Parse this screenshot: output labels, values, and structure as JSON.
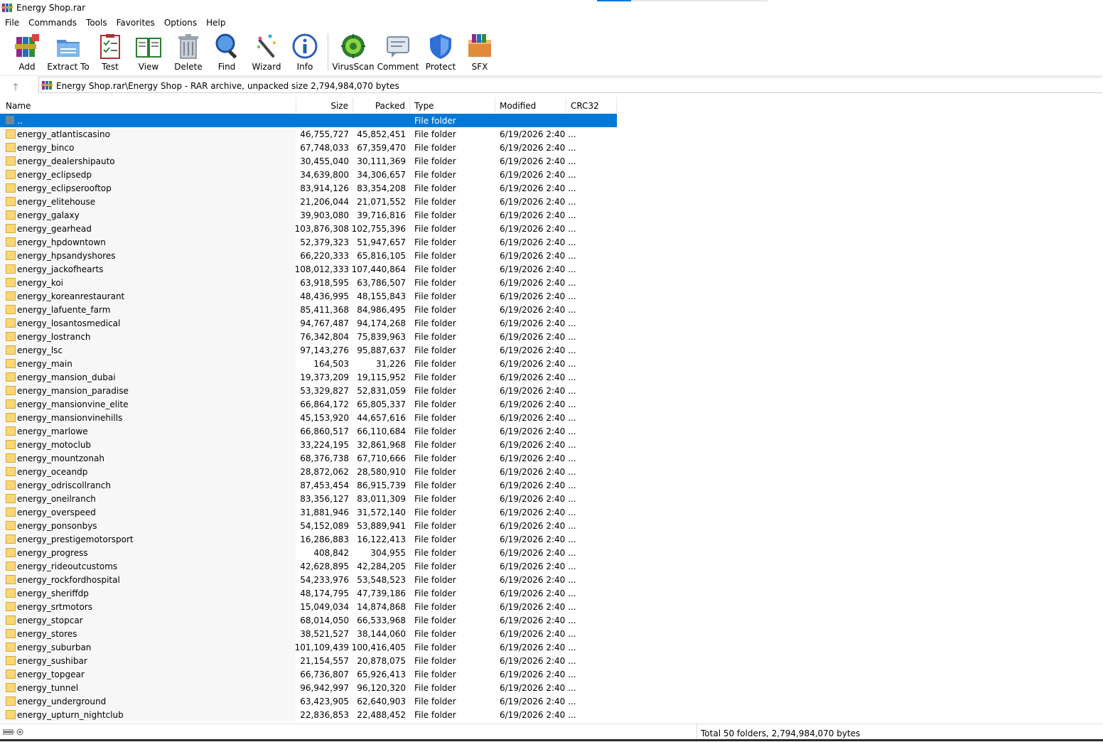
{
  "window": {
    "title": "Energy Shop.rar"
  },
  "menu": [
    "File",
    "Commands",
    "Tools",
    "Favorites",
    "Options",
    "Help"
  ],
  "toolbar": {
    "add": "Add",
    "extract_to": "Extract To",
    "test": "Test",
    "view": "View",
    "delete": "Delete",
    "find": "Find",
    "wizard": "Wizard",
    "info": "Info",
    "virusscan": "VirusScan",
    "comment": "Comment",
    "protect": "Protect",
    "sfx": "SFX"
  },
  "address": {
    "path": "Energy Shop.rar\\Energy Shop - RAR archive, unpacked size 2,794,984,070 bytes"
  },
  "columns": {
    "name": "Name",
    "size": "Size",
    "packed": "Packed",
    "type": "Type",
    "modified": "Modified",
    "crc32": "CRC32"
  },
  "parent_row": {
    "name": "..",
    "type": "File folder"
  },
  "files": [
    {
      "name": "energy_atlantiscasino",
      "size": "46,755,727",
      "packed": "45,852,451",
      "type": "File folder",
      "modified": "6/19/2026 2:40 ..."
    },
    {
      "name": "energy_binco",
      "size": "67,748,033",
      "packed": "67,359,470",
      "type": "File folder",
      "modified": "6/19/2026 2:40 ..."
    },
    {
      "name": "energy_dealershipauto",
      "size": "30,455,040",
      "packed": "30,111,369",
      "type": "File folder",
      "modified": "6/19/2026 2:40 ..."
    },
    {
      "name": "energy_eclipsedp",
      "size": "34,639,800",
      "packed": "34,306,657",
      "type": "File folder",
      "modified": "6/19/2026 2:40 ..."
    },
    {
      "name": "energy_eclipserooftop",
      "size": "83,914,126",
      "packed": "83,354,208",
      "type": "File folder",
      "modified": "6/19/2026 2:40 ..."
    },
    {
      "name": "energy_elitehouse",
      "size": "21,206,044",
      "packed": "21,071,552",
      "type": "File folder",
      "modified": "6/19/2026 2:40 ..."
    },
    {
      "name": "energy_galaxy",
      "size": "39,903,080",
      "packed": "39,716,816",
      "type": "File folder",
      "modified": "6/19/2026 2:40 ..."
    },
    {
      "name": "energy_gearhead",
      "size": "103,876,308",
      "packed": "102,755,396",
      "type": "File folder",
      "modified": "6/19/2026 2:40 ..."
    },
    {
      "name": "energy_hpdowntown",
      "size": "52,379,323",
      "packed": "51,947,657",
      "type": "File folder",
      "modified": "6/19/2026 2:40 ..."
    },
    {
      "name": "energy_hpsandyshores",
      "size": "66,220,333",
      "packed": "65,816,105",
      "type": "File folder",
      "modified": "6/19/2026 2:40 ..."
    },
    {
      "name": "energy_jackofhearts",
      "size": "108,012,333",
      "packed": "107,440,864",
      "type": "File folder",
      "modified": "6/19/2026 2:40 ..."
    },
    {
      "name": "energy_koi",
      "size": "63,918,595",
      "packed": "63,786,507",
      "type": "File folder",
      "modified": "6/19/2026 2:40 ..."
    },
    {
      "name": "energy_koreanrestaurant",
      "size": "48,436,995",
      "packed": "48,155,843",
      "type": "File folder",
      "modified": "6/19/2026 2:40 ..."
    },
    {
      "name": "energy_lafuente_farm",
      "size": "85,411,368",
      "packed": "84,986,495",
      "type": "File folder",
      "modified": "6/19/2026 2:40 ..."
    },
    {
      "name": "energy_losantosmedical",
      "size": "94,767,487",
      "packed": "94,174,268",
      "type": "File folder",
      "modified": "6/19/2026 2:40 ..."
    },
    {
      "name": "energy_lostranch",
      "size": "76,342,804",
      "packed": "75,839,963",
      "type": "File folder",
      "modified": "6/19/2026 2:40 ..."
    },
    {
      "name": "energy_lsc",
      "size": "97,143,276",
      "packed": "95,887,637",
      "type": "File folder",
      "modified": "6/19/2026 2:40 ..."
    },
    {
      "name": "energy_main",
      "size": "164,503",
      "packed": "31,226",
      "type": "File folder",
      "modified": "6/19/2026 2:40 ..."
    },
    {
      "name": "energy_mansion_dubai",
      "size": "19,373,209",
      "packed": "19,115,952",
      "type": "File folder",
      "modified": "6/19/2026 2:40 ..."
    },
    {
      "name": "energy_mansion_paradise",
      "size": "53,329,827",
      "packed": "52,831,059",
      "type": "File folder",
      "modified": "6/19/2026 2:40 ..."
    },
    {
      "name": "energy_mansionvine_elite",
      "size": "66,864,172",
      "packed": "65,805,337",
      "type": "File folder",
      "modified": "6/19/2026 2:40 ..."
    },
    {
      "name": "energy_mansionvinehills",
      "size": "45,153,920",
      "packed": "44,657,616",
      "type": "File folder",
      "modified": "6/19/2026 2:40 ..."
    },
    {
      "name": "energy_marlowe",
      "size": "66,860,517",
      "packed": "66,110,684",
      "type": "File folder",
      "modified": "6/19/2026 2:40 ..."
    },
    {
      "name": "energy_motoclub",
      "size": "33,224,195",
      "packed": "32,861,968",
      "type": "File folder",
      "modified": "6/19/2026 2:40 ..."
    },
    {
      "name": "energy_mountzonah",
      "size": "68,376,738",
      "packed": "67,710,666",
      "type": "File folder",
      "modified": "6/19/2026 2:40 ..."
    },
    {
      "name": "energy_oceandp",
      "size": "28,872,062",
      "packed": "28,580,910",
      "type": "File folder",
      "modified": "6/19/2026 2:40 ..."
    },
    {
      "name": "energy_odriscollranch",
      "size": "87,453,454",
      "packed": "86,915,739",
      "type": "File folder",
      "modified": "6/19/2026 2:40 ..."
    },
    {
      "name": "energy_oneilranch",
      "size": "83,356,127",
      "packed": "83,011,309",
      "type": "File folder",
      "modified": "6/19/2026 2:40 ..."
    },
    {
      "name": "energy_overspeed",
      "size": "31,881,946",
      "packed": "31,572,140",
      "type": "File folder",
      "modified": "6/19/2026 2:40 ..."
    },
    {
      "name": "energy_ponsonbys",
      "size": "54,152,089",
      "packed": "53,889,941",
      "type": "File folder",
      "modified": "6/19/2026 2:40 ..."
    },
    {
      "name": "energy_prestigemotorsport",
      "size": "16,286,883",
      "packed": "16,122,413",
      "type": "File folder",
      "modified": "6/19/2026 2:40 ..."
    },
    {
      "name": "energy_progress",
      "size": "408,842",
      "packed": "304,955",
      "type": "File folder",
      "modified": "6/19/2026 2:40 ..."
    },
    {
      "name": "energy_rideoutcustoms",
      "size": "42,628,895",
      "packed": "42,284,205",
      "type": "File folder",
      "modified": "6/19/2026 2:40 ..."
    },
    {
      "name": "energy_rockfordhospital",
      "size": "54,233,976",
      "packed": "53,548,523",
      "type": "File folder",
      "modified": "6/19/2026 2:40 ..."
    },
    {
      "name": "energy_sheriffdp",
      "size": "48,174,795",
      "packed": "47,739,186",
      "type": "File folder",
      "modified": "6/19/2026 2:40 ..."
    },
    {
      "name": "energy_srtmotors",
      "size": "15,049,034",
      "packed": "14,874,868",
      "type": "File folder",
      "modified": "6/19/2026 2:40 ..."
    },
    {
      "name": "energy_stopcar",
      "size": "68,014,050",
      "packed": "66,533,968",
      "type": "File folder",
      "modified": "6/19/2026 2:40 ..."
    },
    {
      "name": "energy_stores",
      "size": "38,521,527",
      "packed": "38,144,060",
      "type": "File folder",
      "modified": "6/19/2026 2:40 ..."
    },
    {
      "name": "energy_suburban",
      "size": "101,109,439",
      "packed": "100,416,405",
      "type": "File folder",
      "modified": "6/19/2026 2:40 ..."
    },
    {
      "name": "energy_sushibar",
      "size": "21,154,557",
      "packed": "20,878,075",
      "type": "File folder",
      "modified": "6/19/2026 2:40 ..."
    },
    {
      "name": "energy_topgear",
      "size": "66,736,807",
      "packed": "65,926,413",
      "type": "File folder",
      "modified": "6/19/2026 2:40 ..."
    },
    {
      "name": "energy_tunnel",
      "size": "96,942,997",
      "packed": "96,120,320",
      "type": "File folder",
      "modified": "6/19/2026 2:40 ..."
    },
    {
      "name": "energy_underground",
      "size": "63,423,905",
      "packed": "62,640,903",
      "type": "File folder",
      "modified": "6/19/2026 2:40 ..."
    },
    {
      "name": "energy_upturn_nightclub",
      "size": "22,836,853",
      "packed": "22,488,452",
      "type": "File folder",
      "modified": "6/19/2026 2:40 ..."
    }
  ],
  "status": {
    "total": "Total 50 folders, 2,794,984,070 bytes"
  },
  "colors": {
    "selection": "#0078d7",
    "folder": "#f8d775",
    "folder_edge": "#d9a93a"
  }
}
